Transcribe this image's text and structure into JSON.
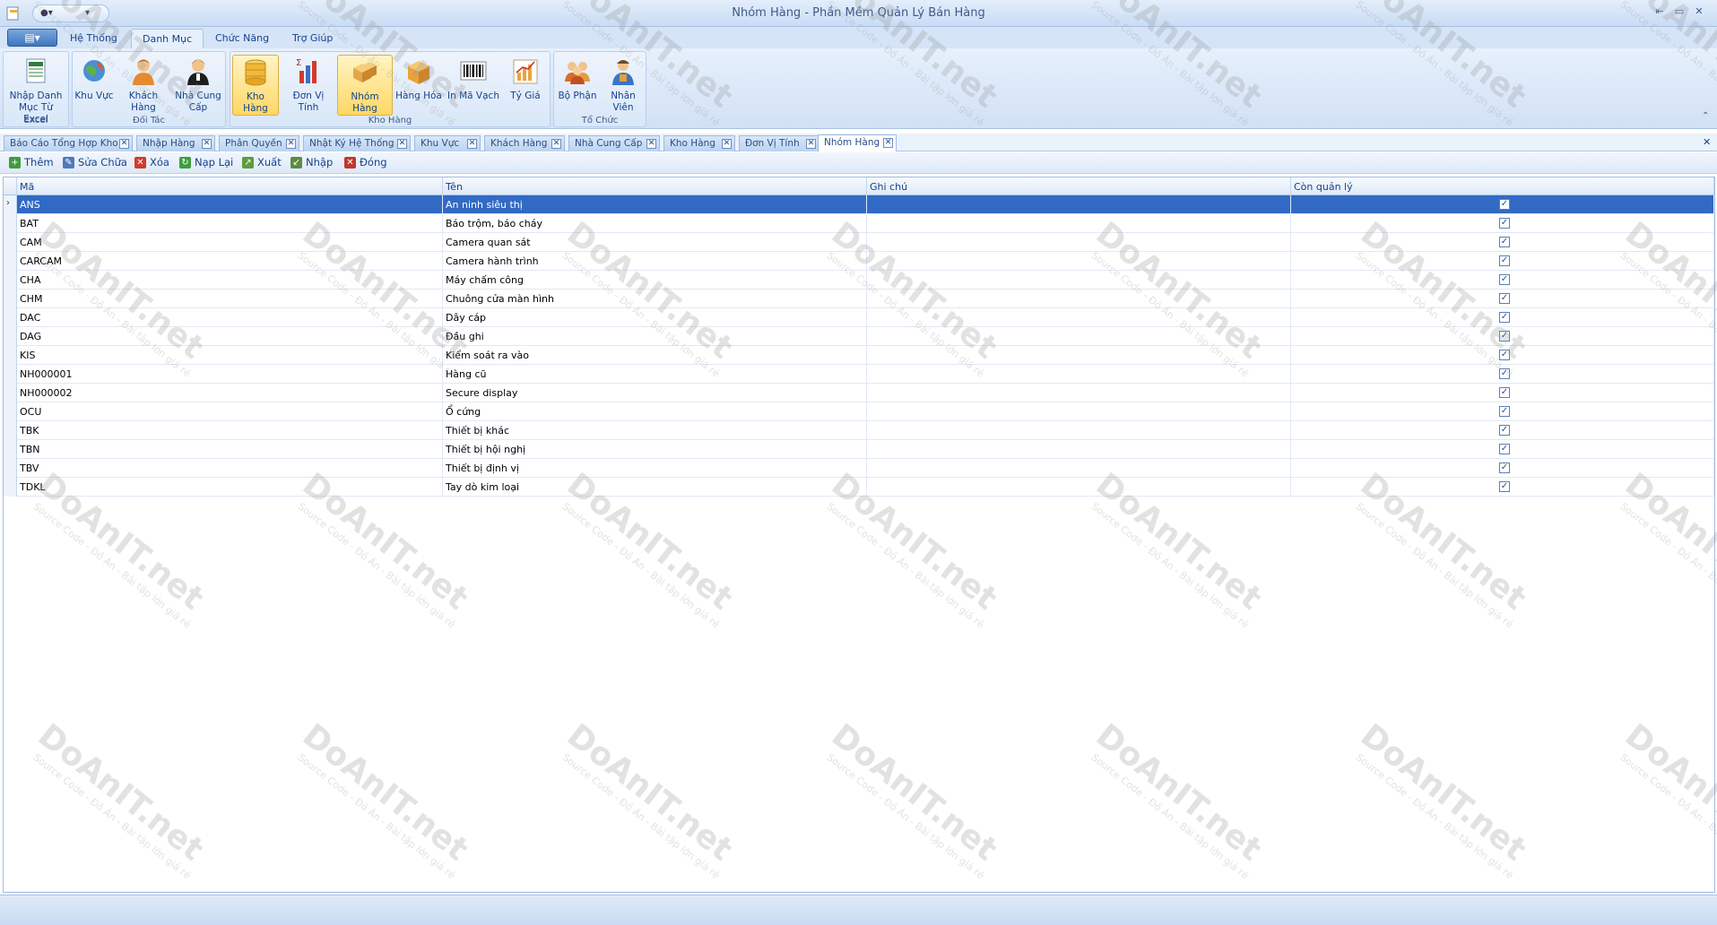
{
  "window": {
    "title": "Nhóm Hàng - Phần Mềm Quản Lý Bán Hàng",
    "controls": [
      "minimize-icon",
      "restore-icon",
      "close-icon"
    ]
  },
  "ribbon": {
    "tabs": [
      {
        "label": "Hệ Thống"
      },
      {
        "label": "Danh Mục"
      },
      {
        "label": "Chức Năng"
      },
      {
        "label": "Trợ Giúp"
      }
    ],
    "active_tab": "Danh Mục",
    "groups": [
      {
        "label": "Excel",
        "buttons": [
          {
            "label": "Nhập Danh Mục Từ Excel",
            "icon": "excel-import-icon"
          }
        ]
      },
      {
        "label": "Đối Tác",
        "buttons": [
          {
            "label": "Khu Vực",
            "icon": "globe-icon"
          },
          {
            "label": "Khách Hàng",
            "icon": "customer-icon"
          },
          {
            "label": "Nhà Cung Cấp",
            "icon": "supplier-icon"
          }
        ]
      },
      {
        "label": "Kho Hàng",
        "buttons": [
          {
            "label": "Kho Hàng",
            "icon": "warehouse-icon"
          },
          {
            "label": "Đơn Vị Tính",
            "icon": "unit-chart-icon"
          },
          {
            "label": "Nhóm Hàng",
            "icon": "boxes-icon"
          },
          {
            "label": "Hàng Hóa",
            "icon": "box-icon"
          },
          {
            "label": "In Mã Vạch",
            "icon": "barcode-icon"
          },
          {
            "label": "Tỷ Giá",
            "icon": "exchange-chart-icon"
          }
        ]
      },
      {
        "label": "Tổ Chức",
        "buttons": [
          {
            "label": "Bộ Phận",
            "icon": "department-icon"
          },
          {
            "label": "Nhân Viên",
            "icon": "employee-icon"
          }
        ]
      }
    ]
  },
  "doc_tabs": [
    {
      "label": "Báo Cáo Tổng Hợp Kho"
    },
    {
      "label": "Nhập Hàng"
    },
    {
      "label": "Phân Quyền"
    },
    {
      "label": "Nhật Ký Hệ Thống"
    },
    {
      "label": "Khu Vực"
    },
    {
      "label": "Khách Hàng"
    },
    {
      "label": "Nhà Cung Cấp"
    },
    {
      "label": "Kho Hàng"
    },
    {
      "label": "Đơn Vị Tính"
    },
    {
      "label": "Nhóm Hàng"
    }
  ],
  "toolbar": {
    "add": "Thêm",
    "edit": "Sửa Chữa",
    "delete": "Xóa",
    "reload": "Nạp Lại",
    "export": "Xuất",
    "import": "Nhập",
    "close": "Đóng"
  },
  "grid": {
    "columns": [
      "Mã",
      "Tên",
      "Ghi chú",
      "Còn quản lý"
    ],
    "rows": [
      {
        "ma": "ANS",
        "ten": "An ninh siêu thị",
        "ghichu": "",
        "conql": true
      },
      {
        "ma": "BAT",
        "ten": "Báo trộm, báo cháy",
        "ghichu": "",
        "conql": true
      },
      {
        "ma": "CAM",
        "ten": "Camera quan sát",
        "ghichu": "",
        "conql": true
      },
      {
        "ma": "CARCAM",
        "ten": "Camera hành trình",
        "ghichu": "",
        "conql": true
      },
      {
        "ma": "CHA",
        "ten": "Máy chấm công",
        "ghichu": "",
        "conql": true
      },
      {
        "ma": "CHM",
        "ten": "Chuông cửa màn hình",
        "ghichu": "",
        "conql": true
      },
      {
        "ma": "DAC",
        "ten": "Dây cáp",
        "ghichu": "",
        "conql": true
      },
      {
        "ma": "DAG",
        "ten": "Đầu ghi",
        "ghichu": "",
        "conql": true
      },
      {
        "ma": "KIS",
        "ten": "Kiểm soát ra vào",
        "ghichu": "",
        "conql": true
      },
      {
        "ma": "NH000001",
        "ten": "Hàng cũ",
        "ghichu": "",
        "conql": true
      },
      {
        "ma": "NH000002",
        "ten": "Secure display",
        "ghichu": "",
        "conql": true
      },
      {
        "ma": "OCU",
        "ten": "Ổ cứng",
        "ghichu": "",
        "conql": true
      },
      {
        "ma": "TBK",
        "ten": "Thiết bị khác",
        "ghichu": "",
        "conql": true
      },
      {
        "ma": "TBN",
        "ten": "Thiết bị hội nghị",
        "ghichu": "",
        "conql": true
      },
      {
        "ma": "TBV",
        "ten": "Thiết bị định vị",
        "ghichu": "",
        "conql": true
      },
      {
        "ma": "TDKL",
        "ten": "Tay dò kim loại",
        "ghichu": "",
        "conql": true
      }
    ],
    "selected_row": 0
  },
  "watermark": {
    "brand": "DoAnIT.net",
    "tagline": "Source Code - Đồ Án - Bài tập lớn giá rẻ"
  }
}
